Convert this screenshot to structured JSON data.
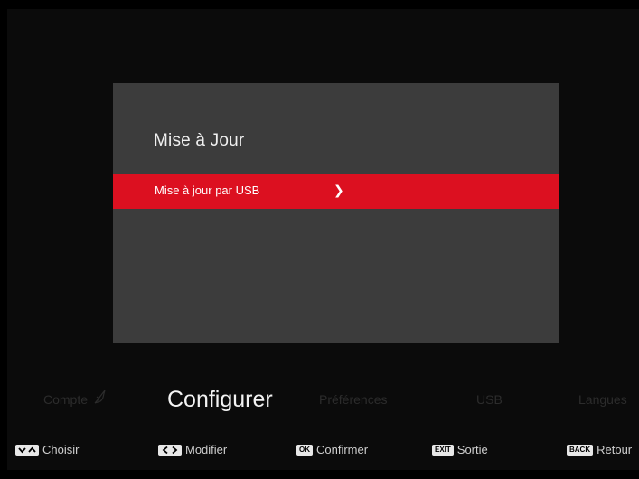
{
  "panel": {
    "title": "Mise à Jour",
    "items": [
      {
        "label": "Mise à jour par USB",
        "chevron": "chevron-right-icon",
        "selected": true
      }
    ]
  },
  "tabs": [
    {
      "label": "Compte",
      "icon": "leaf-icon",
      "active": false
    },
    {
      "label": "Configurer",
      "active": true
    },
    {
      "label": "Préférences",
      "active": false
    },
    {
      "label": "USB",
      "active": false
    },
    {
      "label": "Langues",
      "active": false
    }
  ],
  "legend": [
    {
      "key": "up-down-arrows",
      "label": "Choisir"
    },
    {
      "key": "left-right-arrows",
      "label": "Modifier"
    },
    {
      "key": "OK",
      "label": "Confirmer"
    },
    {
      "key": "EXIT",
      "label": "Sortie"
    },
    {
      "key": "BACK",
      "label": "Retour"
    }
  ],
  "colors": {
    "background": "#000000",
    "panel": "#3c3c3c",
    "selection": "#dc1020",
    "inactive_tab": "#2c2c2c",
    "active_tab": "#f3f3f3"
  }
}
